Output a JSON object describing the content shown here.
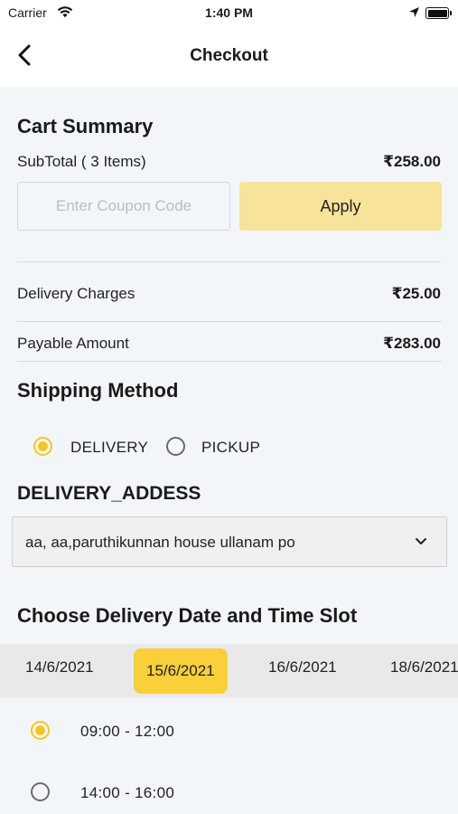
{
  "status_bar": {
    "carrier": "Carrier",
    "time": "1:40 PM"
  },
  "header": {
    "title": "Checkout"
  },
  "cart_summary": {
    "title": "Cart Summary",
    "subtotal_label": "SubTotal ( 3 Items)",
    "subtotal_value": "₹258.00",
    "coupon_placeholder": "Enter Coupon Code",
    "coupon_value": "",
    "apply_label": "Apply",
    "delivery_charges_label": "Delivery Charges",
    "delivery_charges_value": "₹25.00",
    "payable_label": "Payable Amount",
    "payable_value": "₹283.00"
  },
  "shipping": {
    "title": "Shipping Method",
    "options": [
      {
        "label": "DELIVERY",
        "selected": true
      },
      {
        "label": "PICKUP",
        "selected": false
      }
    ]
  },
  "address": {
    "title": "DELIVERY_ADDESS",
    "selected": "aa, aa,paruthikunnan house ullanam po"
  },
  "schedule": {
    "title": "Choose Delivery Date and Time Slot",
    "dates": [
      {
        "label": "14/6/2021",
        "selected": false
      },
      {
        "label": "15/6/2021",
        "selected": true
      },
      {
        "label": "16/6/2021",
        "selected": false
      },
      {
        "label": "18/6/2021",
        "selected": false
      }
    ],
    "slots": [
      {
        "label": "09:00 - 12:00",
        "selected": true
      },
      {
        "label": "14:00 - 16:00",
        "selected": false
      }
    ]
  },
  "colors": {
    "accent": "#f9cf3a",
    "apply_button": "#f7e39a",
    "background": "#f3f6f9"
  },
  "icons": {
    "back": "chevron-left-icon",
    "dropdown": "chevron-down-icon",
    "wifi": "wifi-icon",
    "location": "location-arrow-icon",
    "battery": "battery-icon"
  }
}
